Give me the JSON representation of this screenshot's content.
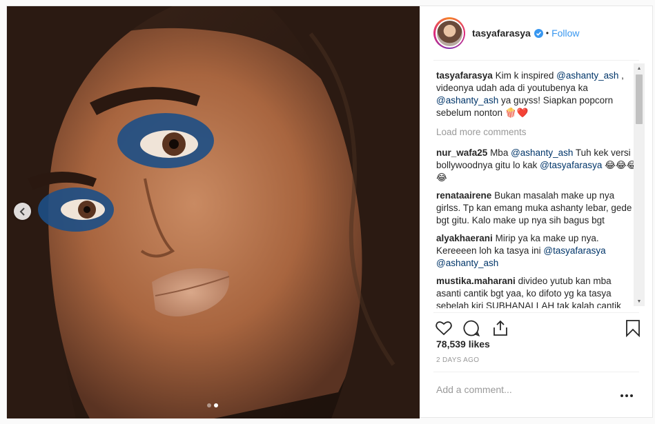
{
  "post": {
    "username": "tasyafarasya",
    "separator": "•",
    "follow_label": "Follow",
    "likes": "78,539 likes",
    "date": "2 DAYS AGO",
    "add_comment_placeholder": "Add a comment...",
    "carousel": {
      "current": 2,
      "total": 2
    }
  },
  "caption": {
    "user": "tasyafarasya",
    "parts": [
      {
        "text": "Kim k inspired "
      },
      {
        "text": "@ashanty_ash",
        "mention": true
      },
      {
        "text": " , videonya udah ada di youtubenya ka "
      },
      {
        "text": "@ashanty_ash",
        "mention": true
      },
      {
        "text": " ya guyss! Siapkan popcorn sebelum nonton 🍿❤️"
      }
    ]
  },
  "load_more": "Load more comments",
  "comments": [
    {
      "user": "nur_wafa25",
      "parts": [
        {
          "text": "Mba "
        },
        {
          "text": "@ashanty_ash",
          "mention": true
        },
        {
          "text": " Tuh kek versi bollywoodnya gitu lo kak "
        },
        {
          "text": "@tasyafarasya",
          "mention": true
        },
        {
          "text": " 😂😂😂😂"
        }
      ]
    },
    {
      "user": "renataairene",
      "parts": [
        {
          "text": "Bukan masalah make up nya girlss. Tp kan emang muka ashanty lebar, gede bgt gitu. Kalo make up nya sih bagus bgt"
        }
      ]
    },
    {
      "user": "alyakhaerani",
      "parts": [
        {
          "text": "Mirip ya ka make up nya. Kereeeen loh ka tasya ini "
        },
        {
          "text": "@tasyafarasya",
          "mention": true
        },
        {
          "text": " "
        },
        {
          "text": "@ashanty_ash",
          "mention": true
        }
      ]
    },
    {
      "user": "mustika.maharani",
      "parts": [
        {
          "text": "divideo yutub kan mba asanti cantik bgt yaa, ko difoto yg ka tasya sebelah kiri SUBHANALLAH tak kalah cantik"
        }
      ]
    }
  ],
  "icons": [
    "heart-icon",
    "comment-icon",
    "share-icon",
    "bookmark-icon",
    "more-options-icon",
    "verified-badge-icon",
    "chevron-left-icon"
  ]
}
